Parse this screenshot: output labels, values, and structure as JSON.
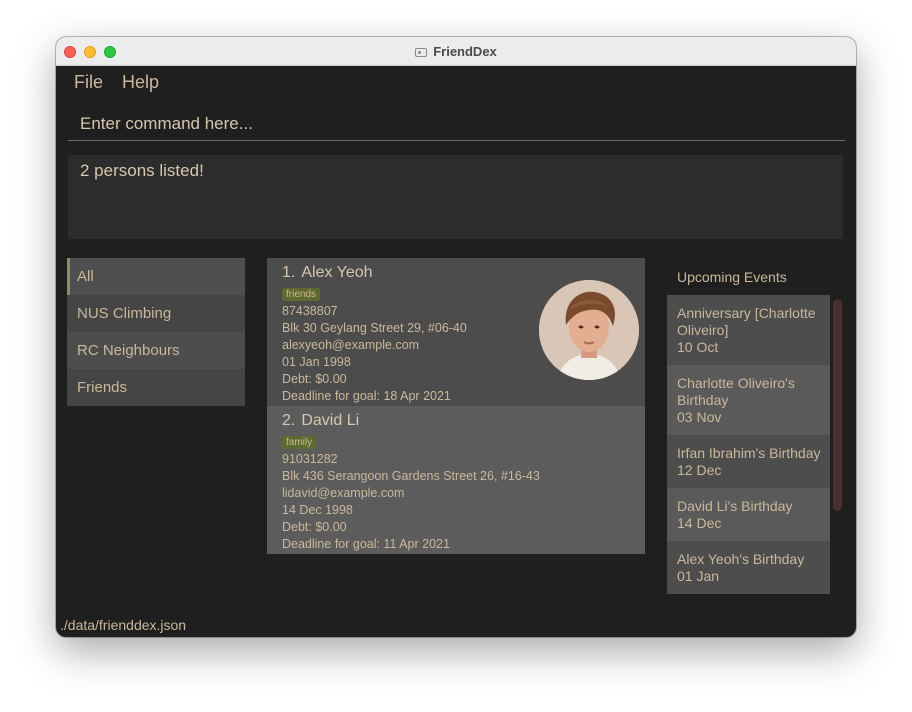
{
  "window": {
    "title": "FriendDex"
  },
  "menu": {
    "file": "File",
    "help": "Help"
  },
  "command": {
    "placeholder": "Enter command here..."
  },
  "result": {
    "message": "2 persons listed!"
  },
  "groups": [
    "All",
    "NUS Climbing",
    "RC Neighbours",
    "Friends"
  ],
  "persons": [
    {
      "index": "1.",
      "name": "Alex Yeoh",
      "tag": "friends",
      "phone": "87438807",
      "address": "Blk 30 Geylang Street 29, #06-40",
      "email": "alexyeoh@example.com",
      "birthday": "01 Jan 1998",
      "debt": "Debt: $0.00",
      "goal": "Deadline for goal: 18 Apr 2021"
    },
    {
      "index": "2.",
      "name": "David Li",
      "tag": "family",
      "phone": "91031282",
      "address": "Blk 436 Serangoon Gardens Street 26, #16-43",
      "email": "lidavid@example.com",
      "birthday": "14 Dec 1998",
      "debt": "Debt: $0.00",
      "goal": "Deadline for goal: 11 Apr 2021"
    }
  ],
  "events": {
    "title": "Upcoming Events",
    "items": [
      {
        "line1": "Anniversary [Charlotte",
        "line2": "Oliveiro]",
        "date": "10 Oct"
      },
      {
        "line1": "Charlotte Oliveiro's",
        "line2": "Birthday",
        "date": "03 Nov"
      },
      {
        "line1": "Irfan Ibrahim's Birthday",
        "line2": "",
        "date": "12 Dec"
      },
      {
        "line1": "David Li's Birthday",
        "line2": "",
        "date": "14 Dec"
      },
      {
        "line1": "Alex Yeoh's Birthday",
        "line2": "",
        "date": "01 Jan"
      }
    ]
  },
  "status": {
    "path": "./data/frienddex.json"
  },
  "colors": {
    "background": "#1f1f1f",
    "text": "#cbb89a",
    "tag": "#5f6a2e",
    "scrollbar": "#4a2e2c"
  }
}
